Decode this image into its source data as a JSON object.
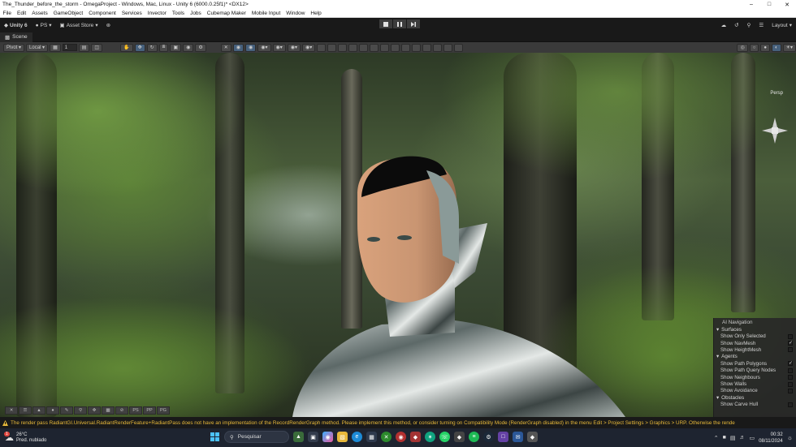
{
  "window": {
    "title": "The_Thunder_before_the_storm - OmegaProject - Windows, Mac, Linux - Unity 6 (6000.0.25f1)* <DX12>",
    "controls": [
      "minimize-icon",
      "maximize-icon",
      "close-icon"
    ]
  },
  "menu": [
    "File",
    "Edit",
    "Assets",
    "GameObject",
    "Component",
    "Services",
    "Invector",
    "Tools",
    "Jobs",
    "Cubemap Maker",
    "Mobile Input",
    "Window",
    "Help"
  ],
  "toolbar": {
    "unity_label": "Unity 6",
    "account_label": "PS",
    "asset_store_label": "Asset Store",
    "layout_label": "Layout"
  },
  "scene_tab": {
    "label": "Scene"
  },
  "scene_toolbar": {
    "pivot_label": "Pivot",
    "local_label": "Local",
    "grid_value": "1"
  },
  "gizmo": {
    "label": "Persp"
  },
  "ai_navigation": {
    "title": "AI Navigation",
    "sections": [
      {
        "name": "Surfaces",
        "items": [
          {
            "label": "Show Only Selected",
            "checked": false
          },
          {
            "label": "Show NavMesh",
            "checked": true
          },
          {
            "label": "Show HeightMesh",
            "checked": false
          }
        ]
      },
      {
        "name": "Agents",
        "items": [
          {
            "label": "Show Path Polygons",
            "checked": true
          },
          {
            "label": "Show Path Query Nodes",
            "checked": false
          },
          {
            "label": "Show Neighbours",
            "checked": false
          },
          {
            "label": "Show Walls",
            "checked": false
          },
          {
            "label": "Show Avoidance",
            "checked": false
          }
        ]
      },
      {
        "name": "Obstacles",
        "items": [
          {
            "label": "Show Carve Hull",
            "checked": false
          }
        ]
      }
    ]
  },
  "overlay_tools": [
    "PS",
    "PP",
    "PG"
  ],
  "console": {
    "message": "The render pass RadiantGI.Universal.RadiantRenderFeature+RadiantPass does not have an implementation of the RecordRenderGraph method. Please implement this method, or consider turning on Compatibility Mode (RenderGraph disabled) in the menu Edit > Project Settings > Graphics > URP. Otherwise the rende"
  },
  "taskbar": {
    "temperature": "26°C",
    "weather_desc": "Pred. nublado",
    "weather_badge": "1",
    "search_placeholder": "Pesquisar",
    "time": "00:32",
    "date": "08/11/2024"
  },
  "colors": {
    "warning": "#e8b93a",
    "menu_bg": "#ffffff",
    "editor_bg": "#191919",
    "taskbar_bg": "#1e2430"
  }
}
